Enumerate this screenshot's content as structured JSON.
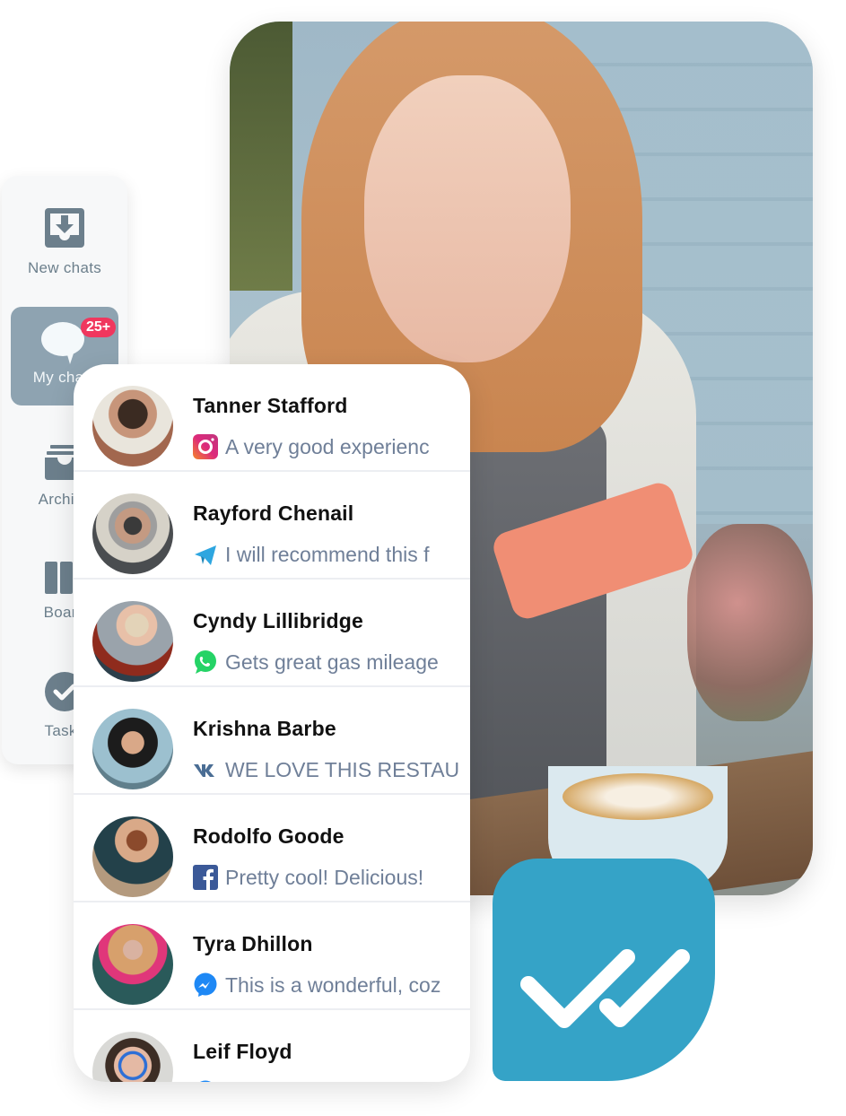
{
  "sidebar": {
    "items": [
      {
        "label": "New chats",
        "icon": "inbox-download-icon",
        "active": false
      },
      {
        "label": "My chats",
        "icon": "chat-bubble-icon",
        "active": true,
        "badge": "25+"
      },
      {
        "label": "Archive",
        "icon": "archive-icon",
        "active": false
      },
      {
        "label": "Board",
        "icon": "board-columns-icon",
        "active": false
      },
      {
        "label": "Tasks",
        "icon": "check-circle-icon",
        "active": false
      }
    ]
  },
  "chats": [
    {
      "name": "Tanner Stafford",
      "channel": "instagram",
      "message": "A very good experienc"
    },
    {
      "name": "Rayford Chenail",
      "channel": "telegram",
      "message": "I will recommend this f"
    },
    {
      "name": "Cyndy Lillibridge",
      "channel": "whatsapp",
      "message": "Gets great gas mileage"
    },
    {
      "name": "Krishna Barbe",
      "channel": "vk",
      "message": "WE LOVE THIS RESTAU"
    },
    {
      "name": "Rodolfo Goode",
      "channel": "facebook",
      "message": "Pretty cool! Delicious!"
    },
    {
      "name": "Tyra Dhillon",
      "channel": "messenger",
      "message": "This is a wonderful, coz"
    },
    {
      "name": "Leif Floyd",
      "channel": "messenger",
      "message": ""
    }
  ],
  "colors": {
    "accent": "#35a3c7",
    "badge": "#f0375e",
    "sidebar_active": "#8ea3b1",
    "muted_text": "#6f7f98"
  }
}
